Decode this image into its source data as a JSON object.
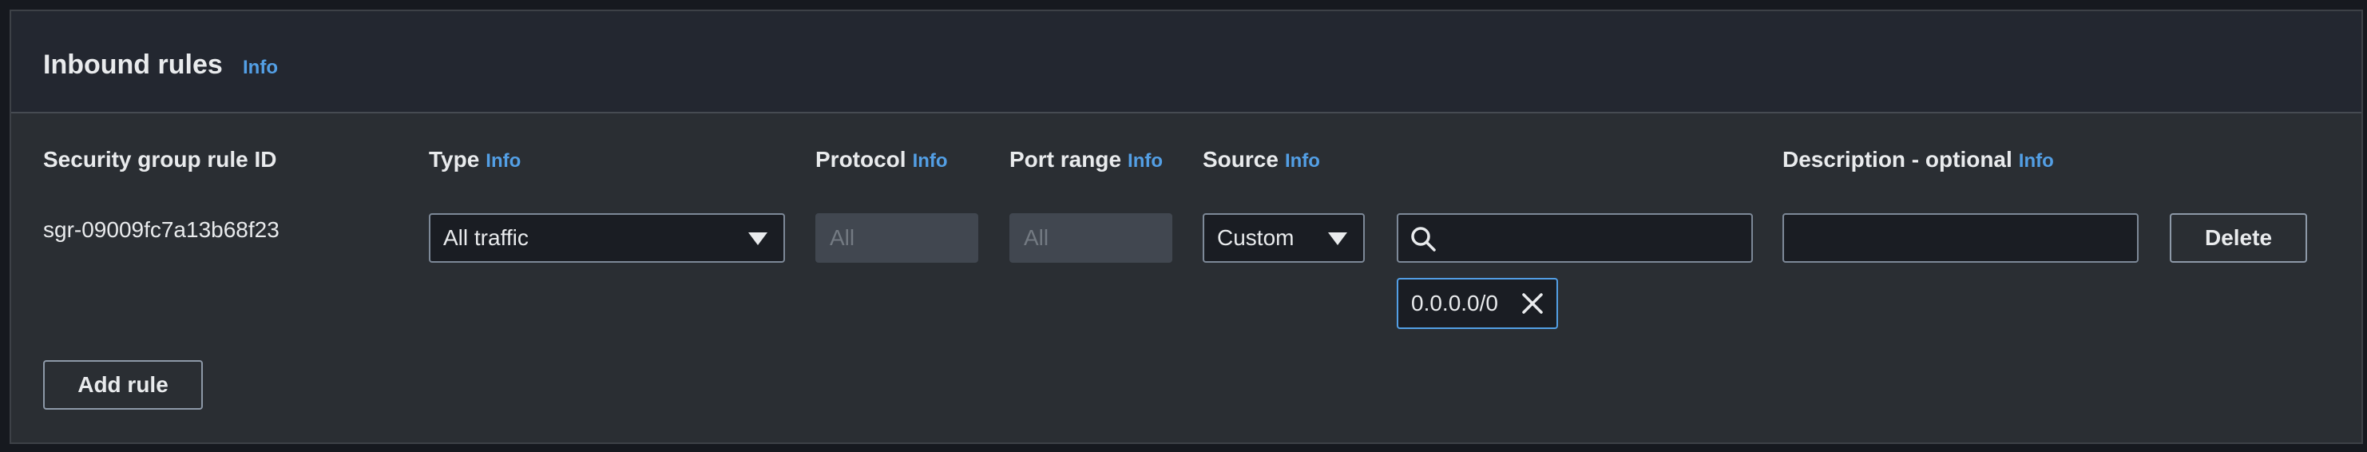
{
  "section": {
    "title": "Inbound rules",
    "info": "Info"
  },
  "columns": {
    "rule_id": "Security group rule ID",
    "type": "Type",
    "protocol": "Protocol",
    "port_range": "Port range",
    "source": "Source",
    "description": "Description - optional",
    "info": "Info"
  },
  "rule": {
    "id": "sgr-09009fc7a13b68f23",
    "type": "All traffic",
    "protocol": "All",
    "port_range": "All",
    "source_type": "Custom",
    "source_search": "",
    "source_token": "0.0.0.0/0",
    "description": "",
    "delete_label": "Delete"
  },
  "add_rule_label": "Add rule",
  "colors": {
    "accent": "#539fe5",
    "background": "#2a2e33",
    "header": "#232730"
  }
}
